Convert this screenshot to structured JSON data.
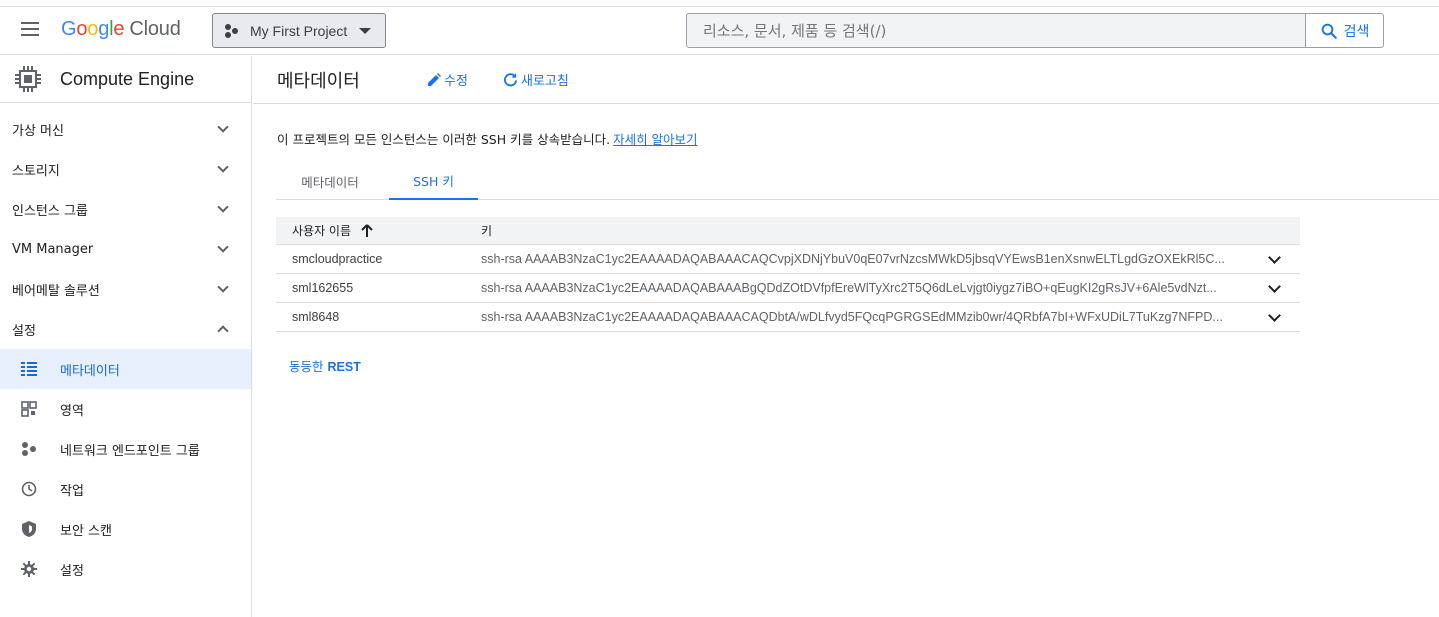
{
  "header": {
    "logo_letters": [
      "G",
      "o",
      "o",
      "g",
      "l",
      "e"
    ],
    "logo_suffix": "Cloud",
    "project_name": "My First Project",
    "search_placeholder": "리소스, 문서, 제품 등 검색(/)",
    "search_button": "검색"
  },
  "sidebar": {
    "product_name": "Compute Engine",
    "groups": [
      {
        "label": "가상 머신",
        "expanded": false
      },
      {
        "label": "스토리지",
        "expanded": false
      },
      {
        "label": "인스턴스 그룹",
        "expanded": false
      },
      {
        "label": "VM Manager",
        "expanded": false
      },
      {
        "label": "베어메탈 솔루션",
        "expanded": false
      },
      {
        "label": "설정",
        "expanded": true
      }
    ],
    "items": [
      {
        "label": "메타데이터",
        "icon": "list-icon",
        "active": true
      },
      {
        "label": "영역",
        "icon": "zones-icon",
        "active": false
      },
      {
        "label": "네트워크 엔드포인트 그룹",
        "icon": "network-endpoint-icon",
        "active": false
      },
      {
        "label": "작업",
        "icon": "clock-icon",
        "active": false
      },
      {
        "label": "보안 스캔",
        "icon": "shield-icon",
        "active": false
      },
      {
        "label": "설정",
        "icon": "gear-icon",
        "active": false
      }
    ]
  },
  "main": {
    "title": "메타데이터",
    "edit_label": "수정",
    "refresh_label": "새로고침",
    "info_text": "이 프로젝트의 모든 인스턴스는 이러한 SSH 키를 상속받습니다.",
    "info_link": "자세히 알아보기",
    "tabs": [
      {
        "label": "메타데이터",
        "active": false
      },
      {
        "label": "SSH 키",
        "active": true
      }
    ],
    "table": {
      "headers": {
        "user": "사용자 이름",
        "key": "키"
      },
      "rows": [
        {
          "user": "smcloudpractice",
          "key": "ssh-rsa AAAAB3NzaC1yc2EAAAADAQABAAACAQCvpjXDNjYbuV0qE07vrNzcsMWkD5jbsqVYEwsB1enXsnwELTLgdGzOXEkRl5C..."
        },
        {
          "user": "sml162655",
          "key": "ssh-rsa AAAAB3NzaC1yc2EAAAADAQABAAABgQDdZOtDVfpfEreWlTyXrc2T5Q6dLeLvjgt0iygz7iBO+qEugKI2gRsJV+6Ale5vdNzt..."
        },
        {
          "user": "sml8648",
          "key": "ssh-rsa AAAAB3NzaC1yc2EAAAADAQABAAACAQDbtA/wDLfvyd5FQcqPGRGSEdMMzib0wr/4QRbfA7bI+WFxUDiL7TuKzg7NFPD..."
        }
      ]
    },
    "rest_prefix": "동등한",
    "rest_label": "REST"
  },
  "colors": {
    "accent": "#1a73e8",
    "active_bg": "#e8f0fe"
  }
}
